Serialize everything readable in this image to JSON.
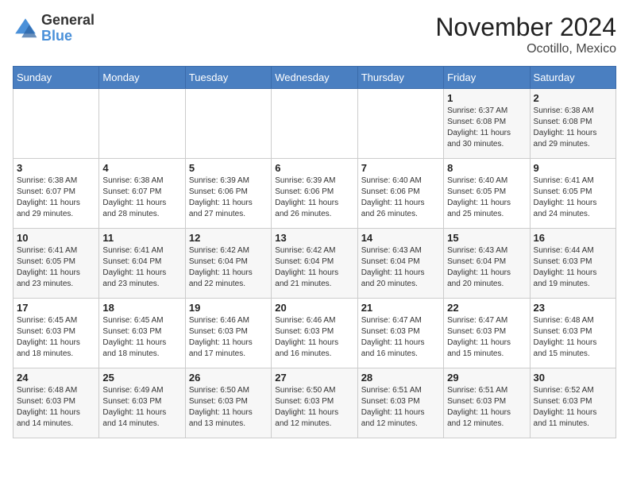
{
  "header": {
    "logo_general": "General",
    "logo_blue": "Blue",
    "month_title": "November 2024",
    "location": "Ocotillo, Mexico"
  },
  "weekdays": [
    "Sunday",
    "Monday",
    "Tuesday",
    "Wednesday",
    "Thursday",
    "Friday",
    "Saturday"
  ],
  "weeks": [
    [
      {
        "day": "",
        "info": ""
      },
      {
        "day": "",
        "info": ""
      },
      {
        "day": "",
        "info": ""
      },
      {
        "day": "",
        "info": ""
      },
      {
        "day": "",
        "info": ""
      },
      {
        "day": "1",
        "info": "Sunrise: 6:37 AM\nSunset: 6:08 PM\nDaylight: 11 hours\nand 30 minutes."
      },
      {
        "day": "2",
        "info": "Sunrise: 6:38 AM\nSunset: 6:08 PM\nDaylight: 11 hours\nand 29 minutes."
      }
    ],
    [
      {
        "day": "3",
        "info": "Sunrise: 6:38 AM\nSunset: 6:07 PM\nDaylight: 11 hours\nand 29 minutes."
      },
      {
        "day": "4",
        "info": "Sunrise: 6:38 AM\nSunset: 6:07 PM\nDaylight: 11 hours\nand 28 minutes."
      },
      {
        "day": "5",
        "info": "Sunrise: 6:39 AM\nSunset: 6:06 PM\nDaylight: 11 hours\nand 27 minutes."
      },
      {
        "day": "6",
        "info": "Sunrise: 6:39 AM\nSunset: 6:06 PM\nDaylight: 11 hours\nand 26 minutes."
      },
      {
        "day": "7",
        "info": "Sunrise: 6:40 AM\nSunset: 6:06 PM\nDaylight: 11 hours\nand 26 minutes."
      },
      {
        "day": "8",
        "info": "Sunrise: 6:40 AM\nSunset: 6:05 PM\nDaylight: 11 hours\nand 25 minutes."
      },
      {
        "day": "9",
        "info": "Sunrise: 6:41 AM\nSunset: 6:05 PM\nDaylight: 11 hours\nand 24 minutes."
      }
    ],
    [
      {
        "day": "10",
        "info": "Sunrise: 6:41 AM\nSunset: 6:05 PM\nDaylight: 11 hours\nand 23 minutes."
      },
      {
        "day": "11",
        "info": "Sunrise: 6:41 AM\nSunset: 6:04 PM\nDaylight: 11 hours\nand 23 minutes."
      },
      {
        "day": "12",
        "info": "Sunrise: 6:42 AM\nSunset: 6:04 PM\nDaylight: 11 hours\nand 22 minutes."
      },
      {
        "day": "13",
        "info": "Sunrise: 6:42 AM\nSunset: 6:04 PM\nDaylight: 11 hours\nand 21 minutes."
      },
      {
        "day": "14",
        "info": "Sunrise: 6:43 AM\nSunset: 6:04 PM\nDaylight: 11 hours\nand 20 minutes."
      },
      {
        "day": "15",
        "info": "Sunrise: 6:43 AM\nSunset: 6:04 PM\nDaylight: 11 hours\nand 20 minutes."
      },
      {
        "day": "16",
        "info": "Sunrise: 6:44 AM\nSunset: 6:03 PM\nDaylight: 11 hours\nand 19 minutes."
      }
    ],
    [
      {
        "day": "17",
        "info": "Sunrise: 6:45 AM\nSunset: 6:03 PM\nDaylight: 11 hours\nand 18 minutes."
      },
      {
        "day": "18",
        "info": "Sunrise: 6:45 AM\nSunset: 6:03 PM\nDaylight: 11 hours\nand 18 minutes."
      },
      {
        "day": "19",
        "info": "Sunrise: 6:46 AM\nSunset: 6:03 PM\nDaylight: 11 hours\nand 17 minutes."
      },
      {
        "day": "20",
        "info": "Sunrise: 6:46 AM\nSunset: 6:03 PM\nDaylight: 11 hours\nand 16 minutes."
      },
      {
        "day": "21",
        "info": "Sunrise: 6:47 AM\nSunset: 6:03 PM\nDaylight: 11 hours\nand 16 minutes."
      },
      {
        "day": "22",
        "info": "Sunrise: 6:47 AM\nSunset: 6:03 PM\nDaylight: 11 hours\nand 15 minutes."
      },
      {
        "day": "23",
        "info": "Sunrise: 6:48 AM\nSunset: 6:03 PM\nDaylight: 11 hours\nand 15 minutes."
      }
    ],
    [
      {
        "day": "24",
        "info": "Sunrise: 6:48 AM\nSunset: 6:03 PM\nDaylight: 11 hours\nand 14 minutes."
      },
      {
        "day": "25",
        "info": "Sunrise: 6:49 AM\nSunset: 6:03 PM\nDaylight: 11 hours\nand 14 minutes."
      },
      {
        "day": "26",
        "info": "Sunrise: 6:50 AM\nSunset: 6:03 PM\nDaylight: 11 hours\nand 13 minutes."
      },
      {
        "day": "27",
        "info": "Sunrise: 6:50 AM\nSunset: 6:03 PM\nDaylight: 11 hours\nand 12 minutes."
      },
      {
        "day": "28",
        "info": "Sunrise: 6:51 AM\nSunset: 6:03 PM\nDaylight: 11 hours\nand 12 minutes."
      },
      {
        "day": "29",
        "info": "Sunrise: 6:51 AM\nSunset: 6:03 PM\nDaylight: 11 hours\nand 12 minutes."
      },
      {
        "day": "30",
        "info": "Sunrise: 6:52 AM\nSunset: 6:03 PM\nDaylight: 11 hours\nand 11 minutes."
      }
    ]
  ]
}
